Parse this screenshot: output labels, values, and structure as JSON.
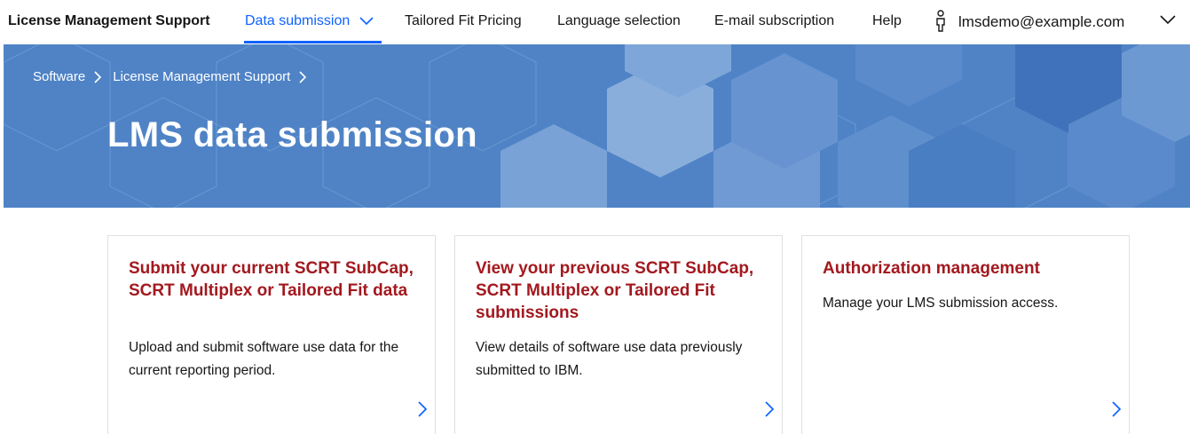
{
  "nav": {
    "brand": "License Management Support",
    "items": [
      {
        "label": "Data submission",
        "active": true
      },
      {
        "label": "Tailored Fit Pricing"
      },
      {
        "label": "Language selection"
      },
      {
        "label": "E-mail subscription"
      },
      {
        "label": "Help"
      }
    ],
    "user_email": "lmsdemo@example.com"
  },
  "hero": {
    "breadcrumb": [
      "Software",
      "License Management Support"
    ],
    "title": "LMS data submission"
  },
  "cards": [
    {
      "title": "Submit your current SCRT SubCap, SCRT Multiplex or Tailored Fit data",
      "description": "Upload and submit software use data for the current reporting period."
    },
    {
      "title": "View your previous SCRT SubCap, SCRT Multiplex or Tailored Fit submissions",
      "description": "View details of software use data previously submitted to IBM."
    },
    {
      "title": "Authorization management",
      "description": "Manage your LMS submission access."
    }
  ],
  "colors": {
    "accent": "#0f62fe",
    "hero_background": "#4f83c6",
    "card_title": "#a2191f"
  },
  "icons": {
    "nav_dropdown": "chevron-down-icon",
    "user": "user-icon",
    "breadcrumb_separator": "chevron-right-icon",
    "card_arrow": "chevron-right-icon"
  }
}
